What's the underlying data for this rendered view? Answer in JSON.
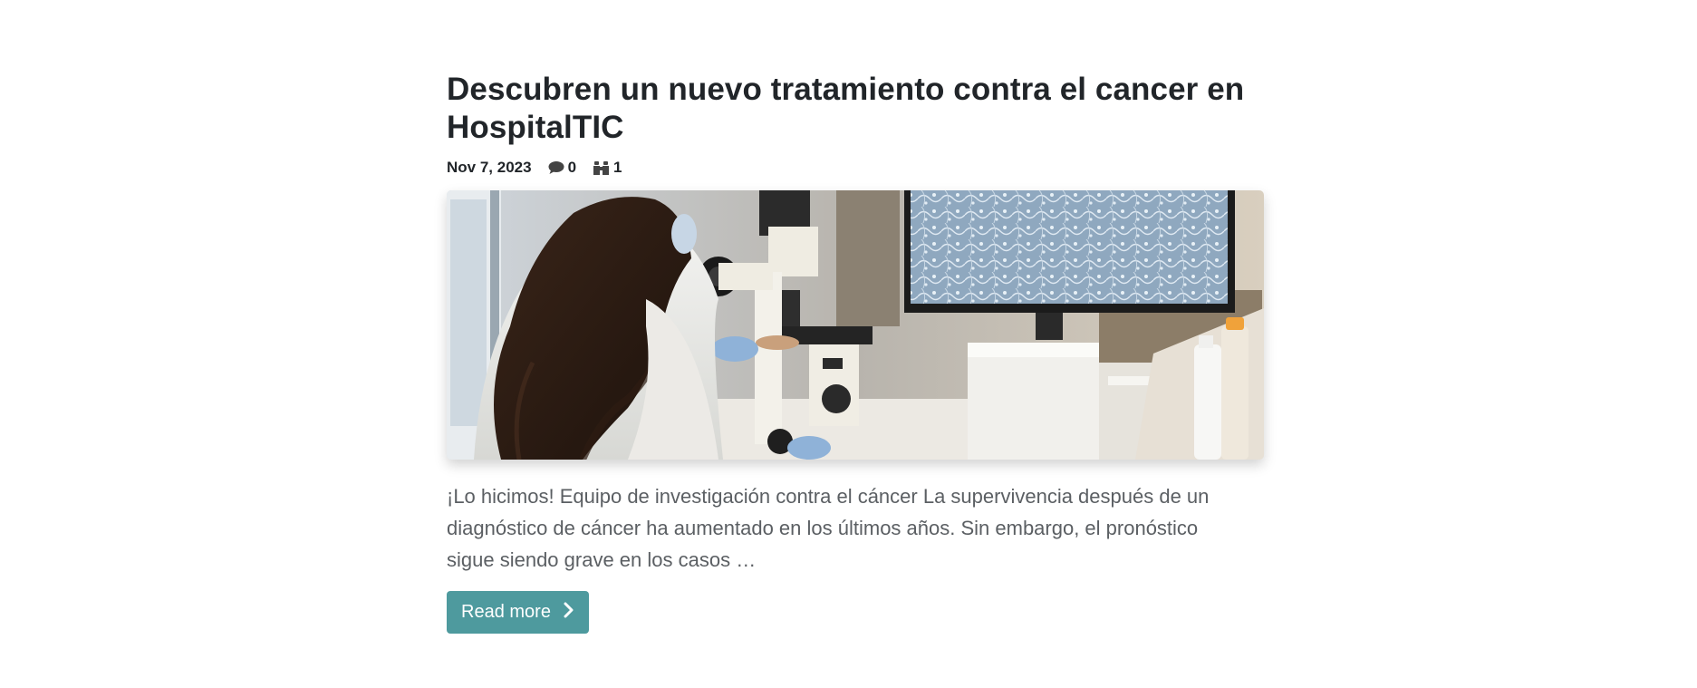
{
  "post": {
    "title": "Descubren un nuevo tratamiento contra el cancer en HospitalTIC",
    "date": "Nov 7, 2023",
    "comments_count": "0",
    "views_count": "1",
    "image_alt": "Investigadora observando muestras en un microscopio junto a un monitor",
    "excerpt": "¡Lo hicimos! Equipo de investigación contra el cáncer La supervivencia después de un diagnóstico de cáncer ha aumentado en los últimos años. Sin embargo, el pronóstico sigue siendo grave en los casos …",
    "read_more_label": "Read more"
  },
  "icons": {
    "comments": "comment-icon",
    "views": "binoculars-icon",
    "read_more": "chevron-right-icon"
  },
  "colors": {
    "button_bg": "#4e9a9e",
    "title_text": "#212529",
    "excerpt_text": "#5b5f63"
  }
}
